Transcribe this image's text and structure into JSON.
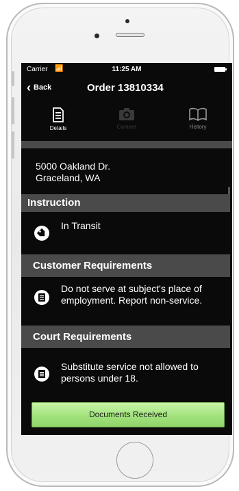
{
  "status_bar": {
    "carrier": "Carrier",
    "wifi_icon": "wifi-icon",
    "time": "11:25 AM",
    "battery_icon": "battery-icon"
  },
  "nav": {
    "back_label": "Back",
    "title": "Order 13810334"
  },
  "tabs": [
    {
      "label": "Details",
      "icon": "document-icon",
      "state": "active"
    },
    {
      "label": "Camera",
      "icon": "camera-icon",
      "state": "disabled"
    },
    {
      "label": "History",
      "icon": "book-icon",
      "state": "inactive"
    }
  ],
  "address": {
    "line1": "5000 Oakland Dr.",
    "line2": "Graceland, WA"
  },
  "sections": {
    "instruction": {
      "header": "Instruction",
      "text": "In Transit",
      "icon": "tag-icon"
    },
    "customer": {
      "header": "Customer Requirements",
      "text": "Do not serve at subject's place of employment. Report non-service.",
      "icon": "document-list-icon"
    },
    "court": {
      "header": "Court Requirements",
      "text": "Substitute service not allowed to persons under 18.",
      "icon": "document-list-icon"
    }
  },
  "action": {
    "button_label": "Documents Received"
  },
  "colors": {
    "screen_bg": "#0a0a0a",
    "section_header_bg": "#4a4a4a",
    "button_green": "#a5e47f",
    "text": "#ffffff"
  }
}
